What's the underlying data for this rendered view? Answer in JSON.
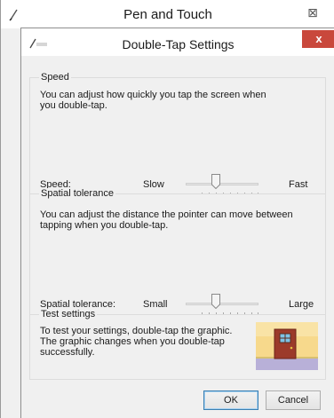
{
  "outer_window": {
    "title": "Pen and Touch",
    "close_glyph": "⊠"
  },
  "dialog": {
    "title": "Double-Tap Settings",
    "close_glyph": "x"
  },
  "speed": {
    "group_label": "Speed",
    "description": "You can adjust how quickly you tap the screen when you double-tap.",
    "row_label": "Speed:",
    "min_label": "Slow",
    "max_label": "Fast",
    "value": 0.4
  },
  "spatial": {
    "group_label": "Spatial tolerance",
    "description": "You can adjust the distance the pointer can move between tapping when you double-tap.",
    "row_label": "Spatial tolerance:",
    "min_label": "Small",
    "max_label": "Large",
    "value": 0.4
  },
  "test": {
    "group_label": "Test settings",
    "description": "To test your settings, double-tap the graphic. The graphic changes when you double-tap successfully."
  },
  "buttons": {
    "ok": "OK",
    "cancel": "Cancel"
  },
  "colors": {
    "close": "#c9483c",
    "accent_border": "#3c7fb1"
  }
}
